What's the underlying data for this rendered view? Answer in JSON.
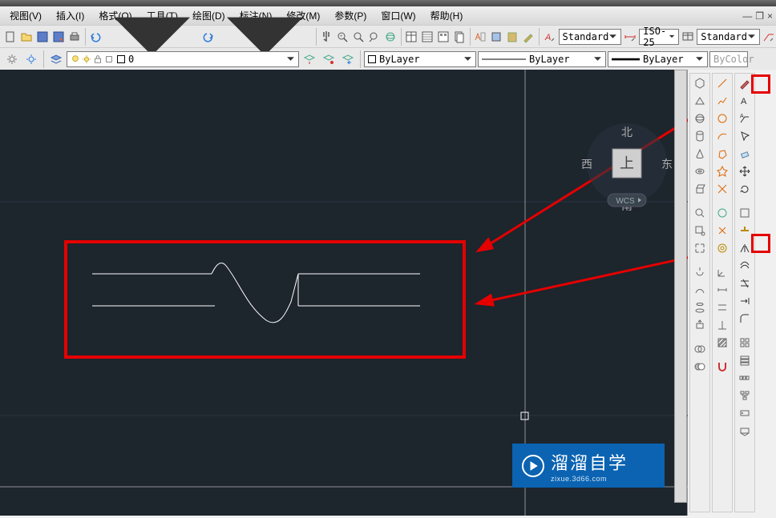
{
  "menu": {
    "view": "视图(V)",
    "insert": "插入(I)",
    "format": "格式(O)",
    "tools": "工具(T)",
    "draw": "绘图(D)",
    "annotate": "标注(N)",
    "modify": "修改(M)",
    "param": "参数(P)",
    "window": "窗口(W)",
    "help": "帮助(H)"
  },
  "window": {
    "minimize": "—",
    "restore": "❐",
    "close": "×"
  },
  "styles": {
    "text": "Standard",
    "dim": "ISO-25",
    "table": "Standard"
  },
  "layer": {
    "current": "0"
  },
  "props": {
    "color": "ByLayer",
    "linetype": "ByLayer",
    "lineweight": "ByLayer",
    "extra": "ByColor"
  },
  "viewcube": {
    "north": "北",
    "south": "南",
    "east": "东",
    "west": "西",
    "top": "上",
    "wcs": "WCS"
  },
  "watermark": {
    "title": "溜溜自学",
    "sub": "zixue.3d66.com"
  }
}
